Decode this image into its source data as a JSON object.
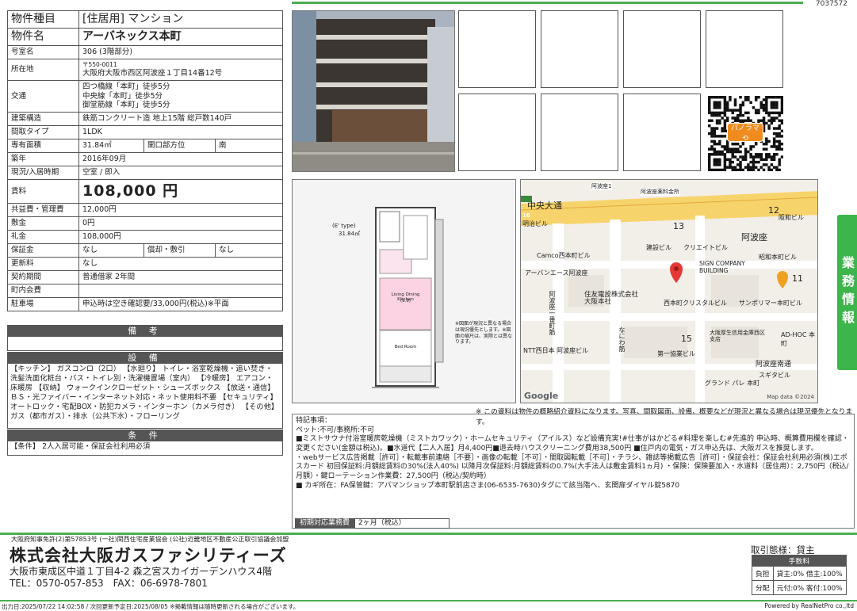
{
  "doc_number": "7037572",
  "rows": {
    "type": {
      "label": "物件種目",
      "value": "[住居用] マンション"
    },
    "name": {
      "label": "物件名",
      "value": "アーバネックス本町"
    },
    "room": {
      "label": "号室名",
      "value": "306 (3階部分)"
    },
    "address": {
      "label": "所在地",
      "zip": "〒550-0011",
      "value": "大阪府大阪市西区阿波座１丁目14番12号"
    },
    "transport": {
      "label": "交通",
      "lines": [
        "四つ橋線「本町」徒歩5分",
        "中央線「本町」徒歩5分",
        "御堂筋線「本町」徒歩5分"
      ]
    },
    "structure": {
      "label": "建築構造",
      "value": "鉄筋コンクリート造 地上15階 総戸数140戸"
    },
    "layout": {
      "label": "間取タイプ",
      "value": "1LDK"
    },
    "area": {
      "label": "専有面積",
      "value": "31.84㎡",
      "dir_label": "開口部方位",
      "dir_value": "南"
    },
    "built": {
      "label": "築年",
      "value": "2016年09月"
    },
    "status": {
      "label": "現況/入居時期",
      "value": "空室 / 即入"
    },
    "rent": {
      "label": "賃料",
      "value": "108,000 円"
    },
    "common": {
      "label": "共益費・管理費",
      "value": "12,000円"
    },
    "shikikin": {
      "label": "敷金",
      "value": "0円"
    },
    "reikin": {
      "label": "礼金",
      "value": "108,000円"
    },
    "deposit": {
      "label": "保証金",
      "value": "なし",
      "sub_label": "償却・敷引",
      "sub_value": "なし"
    },
    "renewal": {
      "label": "更新料",
      "value": "なし"
    },
    "contract": {
      "label": "契約期間",
      "value": "普通借家 2年間"
    },
    "insurance": {
      "label": "町内会費",
      "value": ""
    },
    "parking": {
      "label": "駐車場",
      "value": "申込時は空き確認要/33,000円(税込)※平面"
    }
  },
  "sections": {
    "remarks_title": "備 考",
    "remarks": "",
    "equipment_title": "設 備",
    "equipment": "【キッチン】 ガスコンロ（2口） 【水廻り】 トイレ・浴室乾燥機・追い焚き・洗髪洗面化粧台・バス・トイレ別・洗濯機置場（室内） 【冷暖房】 エアコン・床暖房 【収納】 ウォークインクローゼット・シューズボックス 【放送・通信】 ＢＳ・光ファイバー・インターネット対応・ネット使用料不要 【セキュリティ】 オートロック・宅配BOX・防犯カメラ・インターホン（カメラ付き） 【その他】 ガス（都市ガス）・排水（公共下水）・フローリング",
    "conditions_title": "条 件",
    "conditions": "【条件】 2人入居可能・保証会社利用必須"
  },
  "floorplan": {
    "type_label": "(E' type)",
    "area": "31.84㎡",
    "room_label": "Living Dining Kitchen",
    "room_size": "(9.9)",
    "bed_label": "Bed Room",
    "note": "※図面が現況と異なる場合は現況優先とします。※図面の縮尺は、実際とは異なります。"
  },
  "map": {
    "labels": [
      "中央大通",
      "阿波座1",
      "阿波座南通",
      "阿波座",
      "明治ビル",
      "Camco西本町ビル",
      "アーバンエース阿波座",
      "住友電設株式会社 大阪本社",
      "西本町クリスタルビル",
      "サンポリマー本町ビル",
      "NTT西日本 阿波座ビル",
      "第一協業ビル",
      "大阪厚生信用金庫西区支店",
      "AD-HOC 本町",
      "スギタビル",
      "グランド パレ 本町",
      "昭和本町ビル",
      "阪和ビル",
      "建設ビル",
      "クリエイトビル",
      "SIGN COMPANY BUILDING",
      "阿波座薬料金所",
      "なにわ筋",
      "阿波座一番町筋",
      "13",
      "12",
      "11",
      "15",
      "16"
    ],
    "google": "Google",
    "copyright": "Map data ©2024"
  },
  "qr_label": "パノラマ",
  "side_tab": "業務情報",
  "note": "※ この資料は物件の概略紹介資料になります。写真、間取図面、設備、概要などが現況と異なる場合は現況優先となります。",
  "special": {
    "title": "特記事項：",
    "lines": [
      "ペット:不可/事務所:不可",
      "■ミストサウナ付浴室暖房乾燥機（ミストカワック）・ホームセキュリティ（アイルス）など設備充実!#仕事がはかどる#料理を楽しむ#先進的 申込時、概算費用欄を確認・変更ください(金額は税込)。■水道代【二人入居】月4,400円■退去時ハウスクリーニング費用38,500円 ■住戸内の電気・ガス申込先は、大阪ガスを推奨します。",
      "・webサービス広告掲載［許可］・転載事前連絡［不要］・画像の転載［不可］・間取図転載［不可］・チラシ、雑誌等掲載広告［許可］・保証会社：保証会社利用必須(株)エポスカード 初回保証料:月額総賃料の30%(法人40%) 以降月次保証料:月額総賃料の0.7%(大手法人は敷金賃料1ヵ月) ・保険：保険要加入・水道料（居住用）：2,750円（税込/月額）・鍵ローテーション作業費：27,500円（税込/契約時）",
      "■ カギ所在：FA保管鍵：アパマンショップ本町駅前店さま(06-6535-7630)タグにて該当階へ、玄関扉ダイヤル錠5870"
    ]
  },
  "initial": {
    "label": "初期対応業務費",
    "value": "2ヶ月（税込）"
  },
  "license": "大阪府知事免許(2)第57853号 (一社)関西住宅産業協会 (公社)近畿地区不動産公正取引協議会加盟",
  "company": "株式会社大阪ガスファシリティーズ",
  "company_address": "大阪市東成区中道１丁目4-2 森之宮スカイガーデンハウス4階",
  "tel": "TEL：0570-057-853　FAX：06-6978-7801",
  "trade": "取引態様：貸主",
  "fee": {
    "header": "手数料",
    "rows": [
      {
        "label": "負担",
        "value": "貸主:0% 借主:100%"
      },
      {
        "label": "分配",
        "value": "元付:0% 客付:100%"
      }
    ]
  },
  "printed": "出力日:2025/07/22 14:02:58 / 次回更新予定日:2025/08/05 ※掲載情報は随時更新される場合がございます。",
  "powered": "Powered by RealNetPro co.,ltd",
  "colors": {
    "accent": "#4caf50",
    "side_tab": "#3cb54a",
    "section_bar": "#555555",
    "pin": "#e53935"
  }
}
